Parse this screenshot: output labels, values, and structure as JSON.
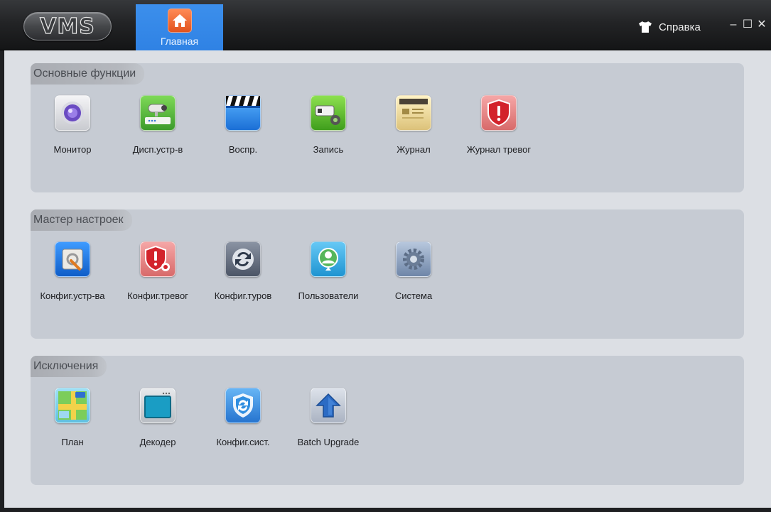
{
  "app": {
    "logo_text": "VMS"
  },
  "header": {
    "home_tab_label": "Главная",
    "help_label": "Справка"
  },
  "window_controls": {
    "minimize": "–",
    "maximize": "☐",
    "close": "✕"
  },
  "sections": [
    {
      "title": "Основные функции",
      "items": [
        {
          "label": "Монитор",
          "icon": "monitor-camera-icon"
        },
        {
          "label": "Дисп.устр-в",
          "icon": "device-manager-icon"
        },
        {
          "label": "Воспр.",
          "icon": "playback-clapper-icon"
        },
        {
          "label": "Запись",
          "icon": "record-config-icon"
        },
        {
          "label": "Журнал",
          "icon": "log-book-icon"
        },
        {
          "label": "Журнал тревог",
          "icon": "alarm-log-shield-icon"
        }
      ]
    },
    {
      "title": "Мастер настроек",
      "items": [
        {
          "label": "Конфиг.устр-ва",
          "icon": "device-config-icon"
        },
        {
          "label": "Конфиг.тревог",
          "icon": "alarm-config-icon"
        },
        {
          "label": "Конфиг.туров",
          "icon": "tour-config-icon"
        },
        {
          "label": "Пользователи",
          "icon": "users-icon"
        },
        {
          "label": "Система",
          "icon": "system-gear-icon"
        }
      ]
    },
    {
      "title": "Исключения",
      "items": [
        {
          "label": "План",
          "icon": "map-plan-icon"
        },
        {
          "label": "Декодер",
          "icon": "decoder-icon"
        },
        {
          "label": "Конфиг.сист.",
          "icon": "system-config-icon"
        },
        {
          "label": "Batch Upgrade",
          "icon": "batch-upgrade-icon"
        }
      ]
    }
  ]
}
